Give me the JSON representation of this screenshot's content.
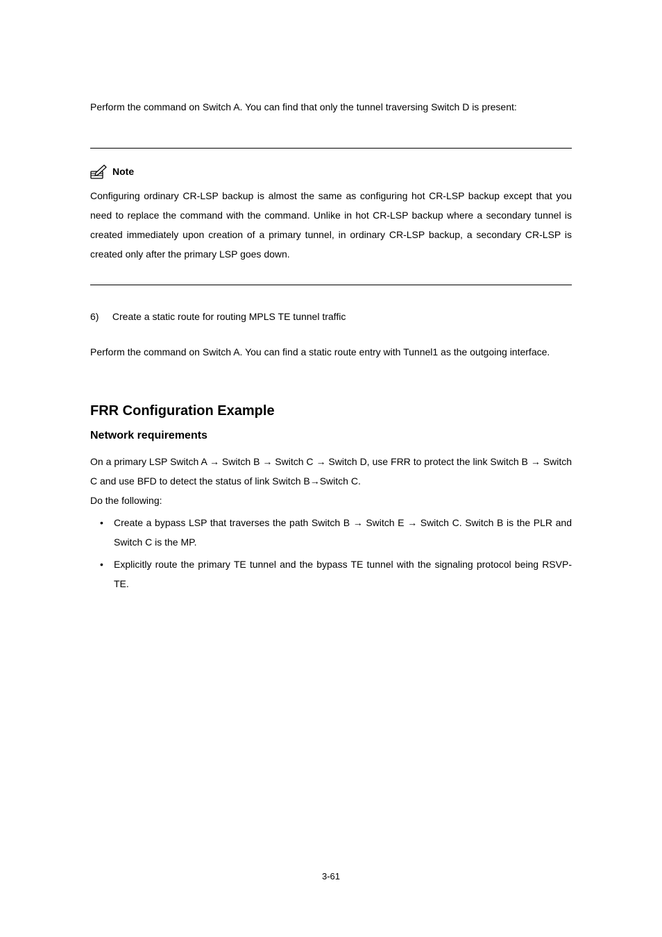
{
  "para1": "Perform the ",
  "para1b": " command on Switch A. You can find that only the tunnel traversing Switch D is present:",
  "note": {
    "label": "Note",
    "body_a": "Configuring ordinary CR-LSP backup is almost the same as configuring hot CR-LSP backup except that you need to replace the ",
    "body_b": " command with the ",
    "body_c": " command. Unlike in hot CR-LSP backup where a secondary tunnel is created immediately upon creation of a primary tunnel, in ordinary CR-LSP backup, a secondary CR-LSP is created only after the primary LSP goes down."
  },
  "step6": {
    "num": "6)",
    "text": "Create a static route for routing MPLS TE tunnel traffic"
  },
  "para2a": "Perform the ",
  "para2b": " command on Switch A. You can find a static route entry with Tunnel1 as the outgoing interface.",
  "section_title": "FRR Configuration Example",
  "subsection_title": "Network requirements",
  "req_line1": "On a primary LSP Switch A → Switch B → Switch C → Switch D, use FRR to protect the link Switch B → Switch C and use BFD to detect the status of link Switch B→Switch C.",
  "req_line2": "Do the following:",
  "bullets": [
    "Create a bypass LSP that traverses the path Switch B → Switch E → Switch C. Switch B is the PLR and Switch C is the MP.",
    "Explicitly route the primary TE tunnel and the bypass TE tunnel with the signaling protocol being RSVP-TE."
  ],
  "page_number": "3-61"
}
